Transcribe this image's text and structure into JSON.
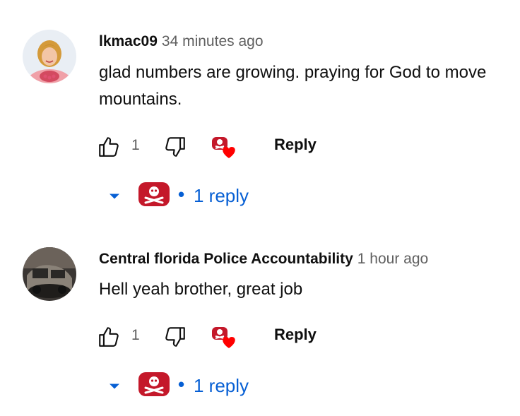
{
  "comments": [
    {
      "author": "lkmac09",
      "timestamp": "34 minutes ago",
      "text": "glad numbers are growing. praying for God to move mountains.",
      "likes": "1",
      "reply_label": "Reply",
      "replies_label": "1 reply",
      "avatar_icon": "woman-avatar-icon",
      "hearted": true
    },
    {
      "author": "Central florida Police Accountability",
      "timestamp": "1 hour ago",
      "text": "Hell yeah brother, great job",
      "likes": "1",
      "reply_label": "Reply",
      "replies_label": "1 reply",
      "avatar_icon": "vehicle-avatar-icon",
      "hearted": true
    }
  ],
  "colors": {
    "link_blue": "#065fd4",
    "heart_red": "#ff0000",
    "creator_badge_red": "#c4182a",
    "secondary_text": "#606060"
  },
  "dot_separator": "•"
}
